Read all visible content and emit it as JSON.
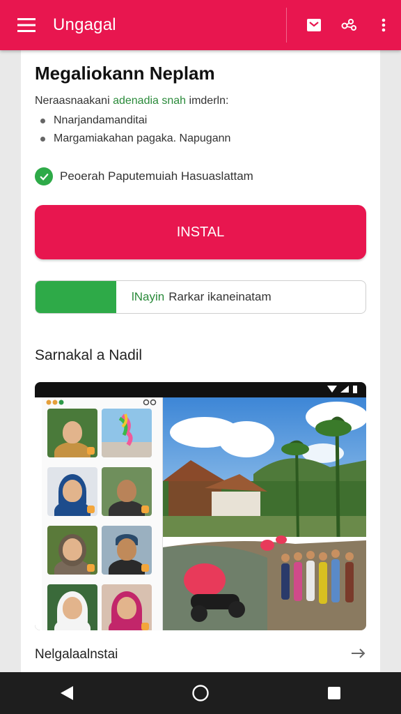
{
  "appbar": {
    "title": "Ungagal",
    "icons": [
      "menu-icon",
      "bookmark-icon",
      "share-icon",
      "more-vertical-icon"
    ]
  },
  "main": {
    "title": "Megaliokann Neplam",
    "desc_prefix": "Neraasnaakani ",
    "desc_highlight": "adenadia snah",
    "desc_suffix": " imderln:",
    "bullets": [
      "Nnarjandamanditai",
      "Margamiakahan pagaka. Napugann"
    ],
    "verified_text": "Peoerah Paputemuiah Hasuaslattam",
    "install_label": "INSTAL",
    "progress_value": 0.245,
    "progress_green": "lNayin",
    "progress_text": "Rarkar ikaneinatam",
    "screenshots_title": "Sarnakal a Nadil",
    "footer_label": "Nelgalaalnstai"
  },
  "colors": {
    "accent": "#e8164f",
    "success": "#2eaa48",
    "background": "#e9e9e9",
    "navbar": "#1e1e1e"
  },
  "navbar": {
    "icons": [
      "back-icon",
      "home-icon",
      "recents-icon"
    ]
  }
}
